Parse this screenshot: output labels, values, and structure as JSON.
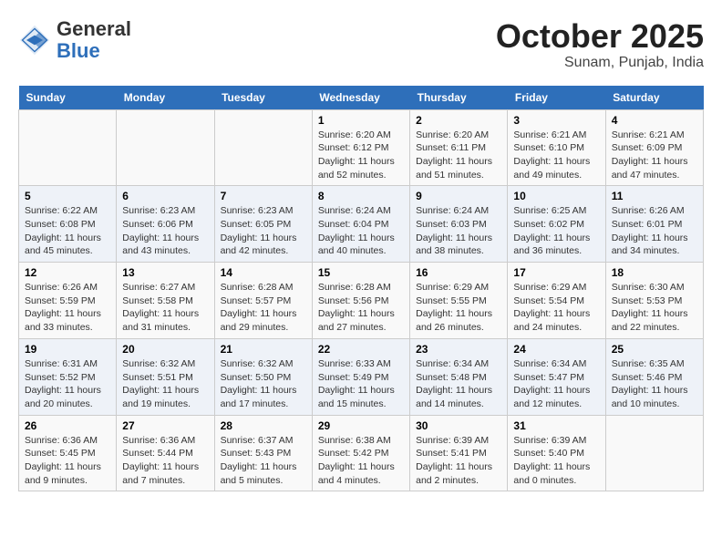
{
  "header": {
    "logo_general": "General",
    "logo_blue": "Blue",
    "month_title": "October 2025",
    "location": "Sunam, Punjab, India"
  },
  "weekdays": [
    "Sunday",
    "Monday",
    "Tuesday",
    "Wednesday",
    "Thursday",
    "Friday",
    "Saturday"
  ],
  "weeks": [
    [
      {
        "day": "",
        "info": ""
      },
      {
        "day": "",
        "info": ""
      },
      {
        "day": "",
        "info": ""
      },
      {
        "day": "1",
        "info": "Sunrise: 6:20 AM\nSunset: 6:12 PM\nDaylight: 11 hours\nand 52 minutes."
      },
      {
        "day": "2",
        "info": "Sunrise: 6:20 AM\nSunset: 6:11 PM\nDaylight: 11 hours\nand 51 minutes."
      },
      {
        "day": "3",
        "info": "Sunrise: 6:21 AM\nSunset: 6:10 PM\nDaylight: 11 hours\nand 49 minutes."
      },
      {
        "day": "4",
        "info": "Sunrise: 6:21 AM\nSunset: 6:09 PM\nDaylight: 11 hours\nand 47 minutes."
      }
    ],
    [
      {
        "day": "5",
        "info": "Sunrise: 6:22 AM\nSunset: 6:08 PM\nDaylight: 11 hours\nand 45 minutes."
      },
      {
        "day": "6",
        "info": "Sunrise: 6:23 AM\nSunset: 6:06 PM\nDaylight: 11 hours\nand 43 minutes."
      },
      {
        "day": "7",
        "info": "Sunrise: 6:23 AM\nSunset: 6:05 PM\nDaylight: 11 hours\nand 42 minutes."
      },
      {
        "day": "8",
        "info": "Sunrise: 6:24 AM\nSunset: 6:04 PM\nDaylight: 11 hours\nand 40 minutes."
      },
      {
        "day": "9",
        "info": "Sunrise: 6:24 AM\nSunset: 6:03 PM\nDaylight: 11 hours\nand 38 minutes."
      },
      {
        "day": "10",
        "info": "Sunrise: 6:25 AM\nSunset: 6:02 PM\nDaylight: 11 hours\nand 36 minutes."
      },
      {
        "day": "11",
        "info": "Sunrise: 6:26 AM\nSunset: 6:01 PM\nDaylight: 11 hours\nand 34 minutes."
      }
    ],
    [
      {
        "day": "12",
        "info": "Sunrise: 6:26 AM\nSunset: 5:59 PM\nDaylight: 11 hours\nand 33 minutes."
      },
      {
        "day": "13",
        "info": "Sunrise: 6:27 AM\nSunset: 5:58 PM\nDaylight: 11 hours\nand 31 minutes."
      },
      {
        "day": "14",
        "info": "Sunrise: 6:28 AM\nSunset: 5:57 PM\nDaylight: 11 hours\nand 29 minutes."
      },
      {
        "day": "15",
        "info": "Sunrise: 6:28 AM\nSunset: 5:56 PM\nDaylight: 11 hours\nand 27 minutes."
      },
      {
        "day": "16",
        "info": "Sunrise: 6:29 AM\nSunset: 5:55 PM\nDaylight: 11 hours\nand 26 minutes."
      },
      {
        "day": "17",
        "info": "Sunrise: 6:29 AM\nSunset: 5:54 PM\nDaylight: 11 hours\nand 24 minutes."
      },
      {
        "day": "18",
        "info": "Sunrise: 6:30 AM\nSunset: 5:53 PM\nDaylight: 11 hours\nand 22 minutes."
      }
    ],
    [
      {
        "day": "19",
        "info": "Sunrise: 6:31 AM\nSunset: 5:52 PM\nDaylight: 11 hours\nand 20 minutes."
      },
      {
        "day": "20",
        "info": "Sunrise: 6:32 AM\nSunset: 5:51 PM\nDaylight: 11 hours\nand 19 minutes."
      },
      {
        "day": "21",
        "info": "Sunrise: 6:32 AM\nSunset: 5:50 PM\nDaylight: 11 hours\nand 17 minutes."
      },
      {
        "day": "22",
        "info": "Sunrise: 6:33 AM\nSunset: 5:49 PM\nDaylight: 11 hours\nand 15 minutes."
      },
      {
        "day": "23",
        "info": "Sunrise: 6:34 AM\nSunset: 5:48 PM\nDaylight: 11 hours\nand 14 minutes."
      },
      {
        "day": "24",
        "info": "Sunrise: 6:34 AM\nSunset: 5:47 PM\nDaylight: 11 hours\nand 12 minutes."
      },
      {
        "day": "25",
        "info": "Sunrise: 6:35 AM\nSunset: 5:46 PM\nDaylight: 11 hours\nand 10 minutes."
      }
    ],
    [
      {
        "day": "26",
        "info": "Sunrise: 6:36 AM\nSunset: 5:45 PM\nDaylight: 11 hours\nand 9 minutes."
      },
      {
        "day": "27",
        "info": "Sunrise: 6:36 AM\nSunset: 5:44 PM\nDaylight: 11 hours\nand 7 minutes."
      },
      {
        "day": "28",
        "info": "Sunrise: 6:37 AM\nSunset: 5:43 PM\nDaylight: 11 hours\nand 5 minutes."
      },
      {
        "day": "29",
        "info": "Sunrise: 6:38 AM\nSunset: 5:42 PM\nDaylight: 11 hours\nand 4 minutes."
      },
      {
        "day": "30",
        "info": "Sunrise: 6:39 AM\nSunset: 5:41 PM\nDaylight: 11 hours\nand 2 minutes."
      },
      {
        "day": "31",
        "info": "Sunrise: 6:39 AM\nSunset: 5:40 PM\nDaylight: 11 hours\nand 0 minutes."
      },
      {
        "day": "",
        "info": ""
      }
    ]
  ]
}
